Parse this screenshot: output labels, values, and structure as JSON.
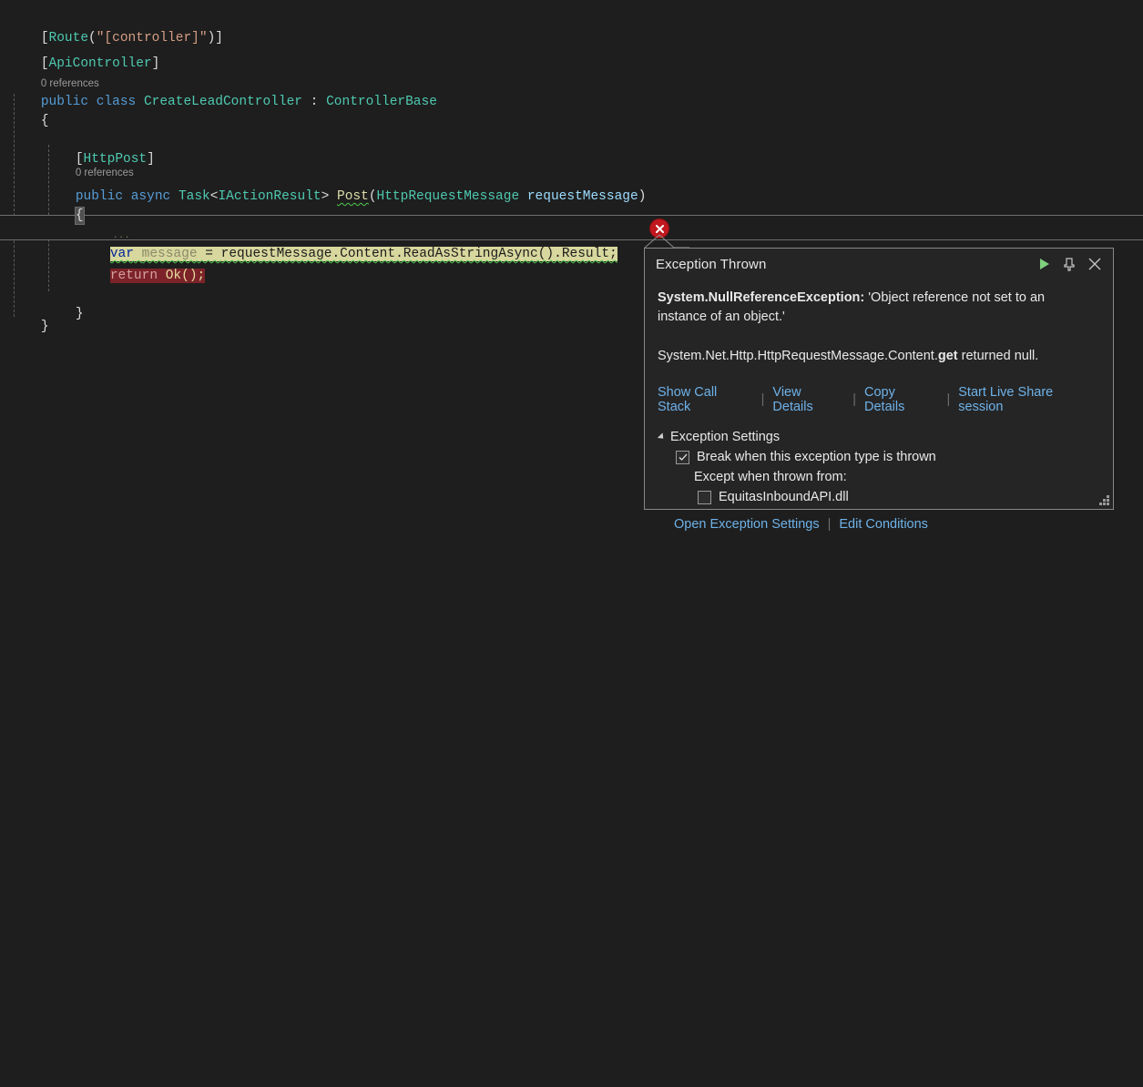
{
  "editor": {
    "lines": [
      {
        "id": "l1",
        "text": "[Route(\"[controller]\")]"
      },
      {
        "id": "l2",
        "text": "[ApiController]"
      },
      {
        "id": "l3",
        "text": "0 references"
      },
      {
        "id": "l4",
        "text": "public class CreateLeadController : ControllerBase"
      },
      {
        "id": "l5",
        "text": "{"
      },
      {
        "id": "l6",
        "text": ""
      },
      {
        "id": "l7",
        "text": "[HttpPost]"
      },
      {
        "id": "l8",
        "text": "0 references"
      },
      {
        "id": "l9",
        "text": "public async Task<IActionResult> Post(HttpRequestMessage requestMessage)"
      },
      {
        "id": "l10",
        "text": "{"
      },
      {
        "id": "l11",
        "text": ""
      },
      {
        "id": "l12",
        "text": "var message = requestMessage.Content.ReadAsStringAsync().Result;"
      },
      {
        "id": "l13",
        "text": "return Ok();"
      },
      {
        "id": "l14",
        "text": ""
      },
      {
        "id": "l15",
        "text": "}"
      },
      {
        "id": "l16",
        "text": "}"
      }
    ],
    "tokens": {
      "route_attr": "Route",
      "route_string": "\"[controller]\"",
      "api_controller": "ApiController",
      "http_post": "HttpPost",
      "kw_public": "public",
      "kw_class": "class",
      "kw_async": "async",
      "kw_var": "var",
      "kw_return": "return",
      "class_name": "CreateLeadController",
      "base_name": "ControllerBase",
      "task_type": "Task",
      "action_result": "IActionResult",
      "method_name": "Post",
      "param_type": "HttpRequestMessage",
      "param_name": "requestMessage",
      "local_var": "message",
      "expr_tail": "requestMessage.Content.ReadAsStringAsync().Result;",
      "ok_call": "Ok();",
      "references_label": "0 references",
      "unused_hint": "..."
    },
    "glyphs": {
      "error_marker": "error-circle-x-icon"
    },
    "colors": {
      "background": "#1e1e1e",
      "current_statement": "#d7d79e",
      "breakpoint_line": "#7c2329",
      "keyword": "#569cd6",
      "type": "#4ec9b0",
      "string": "#d69d85",
      "method": "#dcdcaa",
      "comment_gray": "#9a9a9a",
      "squiggle_green": "#4ec94e"
    }
  },
  "popup": {
    "title": "Exception Thrown",
    "buttons": {
      "continue": "continue-play-icon",
      "pin": "pin-icon",
      "close": "close-icon"
    },
    "exception_type": "System.NullReferenceException:",
    "exception_message": " 'Object reference not set to an instance of an object.'",
    "detail_prefix": "System.Net.Http.HttpRequestMessage.Content.",
    "detail_bold": "get",
    "detail_suffix": " returned null.",
    "links": [
      "Show Call Stack",
      "View Details",
      "Copy Details",
      "Start Live Share session"
    ],
    "settings": {
      "header": "Exception Settings",
      "break_when_label": "Break when this exception type is thrown",
      "break_when_checked": true,
      "except_when_label": "Except when thrown from:",
      "module_label": "EquitasInboundAPI.dll",
      "module_checked": false
    },
    "bottom_links": [
      "Open Exception Settings",
      "Edit Conditions"
    ],
    "separator": "|",
    "resize_grip": "resize-grip-icon",
    "colors": {
      "background": "#252526",
      "border": "#888888",
      "link": "#6eb2e8",
      "play_green": "#7ed07e"
    }
  }
}
